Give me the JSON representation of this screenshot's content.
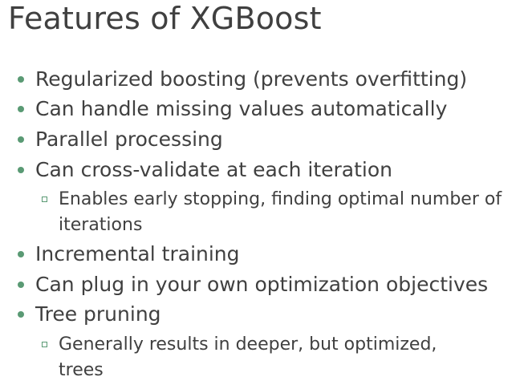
{
  "slide": {
    "title": "Features of XGBoost",
    "bullets": [
      {
        "level": 1,
        "text": "Regularized boosting (prevents overfitting)"
      },
      {
        "level": 1,
        "text": "Can handle missing values automatically"
      },
      {
        "level": 1,
        "text": "Parallel processing"
      },
      {
        "level": 1,
        "text": "Can cross-validate at each iteration"
      },
      {
        "level": 2,
        "text": "Enables early stopping, finding optimal number of iterations"
      },
      {
        "level": 1,
        "text": "Incremental training"
      },
      {
        "level": 1,
        "text": "Can plug in your own optimization objectives"
      },
      {
        "level": 1,
        "text": "Tree pruning"
      },
      {
        "level": 2,
        "text": "Generally results in deeper, but optimized, trees"
      }
    ],
    "colors": {
      "bullet": "#5a9a74",
      "text": "#404040",
      "background": "#ffffff"
    },
    "icons": {
      "level1": "filled-circle-bullet",
      "level2": "hollow-square-bullet"
    }
  }
}
